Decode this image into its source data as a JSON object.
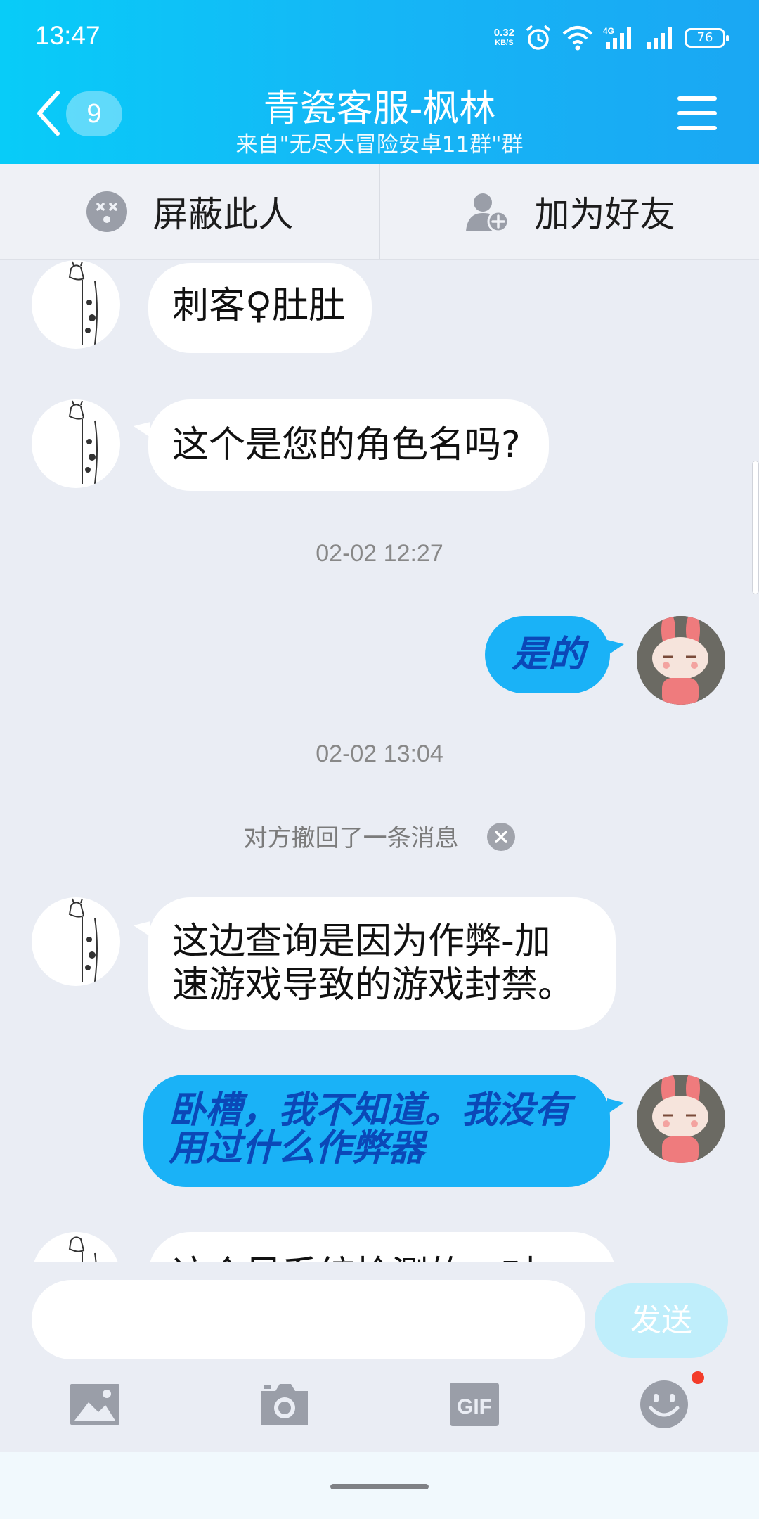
{
  "status": {
    "time": "13:47",
    "speed_top": "0.32",
    "speed_bottom": "KB/S",
    "network": "4G",
    "battery": "76"
  },
  "header": {
    "back_badge": "9",
    "title": "青瓷客服-枫林",
    "subtitle": "来自\"无尽大冒险安卓11群\"群"
  },
  "actions": {
    "block": "屏蔽此人",
    "add_friend": "加为好友"
  },
  "messages": {
    "m1": "刺客♀肚肚",
    "m2": "这个是您的角色名吗?",
    "t1": "02-02 12:27",
    "m3": "是的",
    "t2": "02-02 13:04",
    "recall": "对方撤回了一条消息",
    "m4_line1": "这边查询是因为作弊-加",
    "m4_line2": "速游戏导致的游戏封禁。",
    "m5_line1": "卧槽，我不知道。我没有",
    "m5_line2": "用过什么作弊器",
    "m6_partial": "这个是系统检测的，对"
  },
  "input": {
    "placeholder": "",
    "send_label": "发送"
  },
  "tools": {
    "gif_label": "GIF"
  },
  "colors": {
    "header": "#15b6f6",
    "bubble_out": "#1ab2f7",
    "bubble_out_text": "#0b48b8"
  }
}
